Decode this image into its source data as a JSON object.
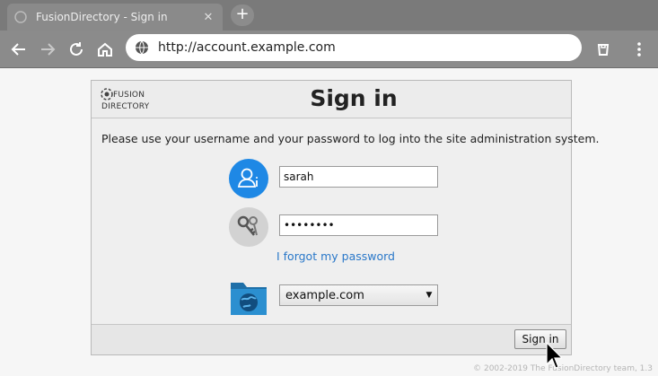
{
  "browser": {
    "tab_title": "FusionDirectory - Sign in",
    "tab_close": "✕",
    "new_tab": "+",
    "url": "http://account.example.com",
    "icons": [
      "back-icon",
      "forward-icon",
      "reload-icon",
      "home-icon",
      "globe-icon",
      "extension-icon",
      "menu-icon"
    ]
  },
  "login": {
    "logo_line1": "FUSION",
    "logo_line2": "DIRECTORY",
    "title": "Sign in",
    "intro": "Please use your username and your password to log into the site administration system.",
    "username_value": "sarah",
    "password_value": "••••••••",
    "forgot_link": "I forgot my password",
    "directory_selected": "example.com",
    "signin_button": "Sign in"
  },
  "footer": {
    "copyright": "© 2002-2019 The FusionDirectory team, 1.3"
  },
  "colors": {
    "accent_blue": "#1e88e5",
    "link": "#2a78c9",
    "chrome_gray": "#8b8b8b"
  }
}
